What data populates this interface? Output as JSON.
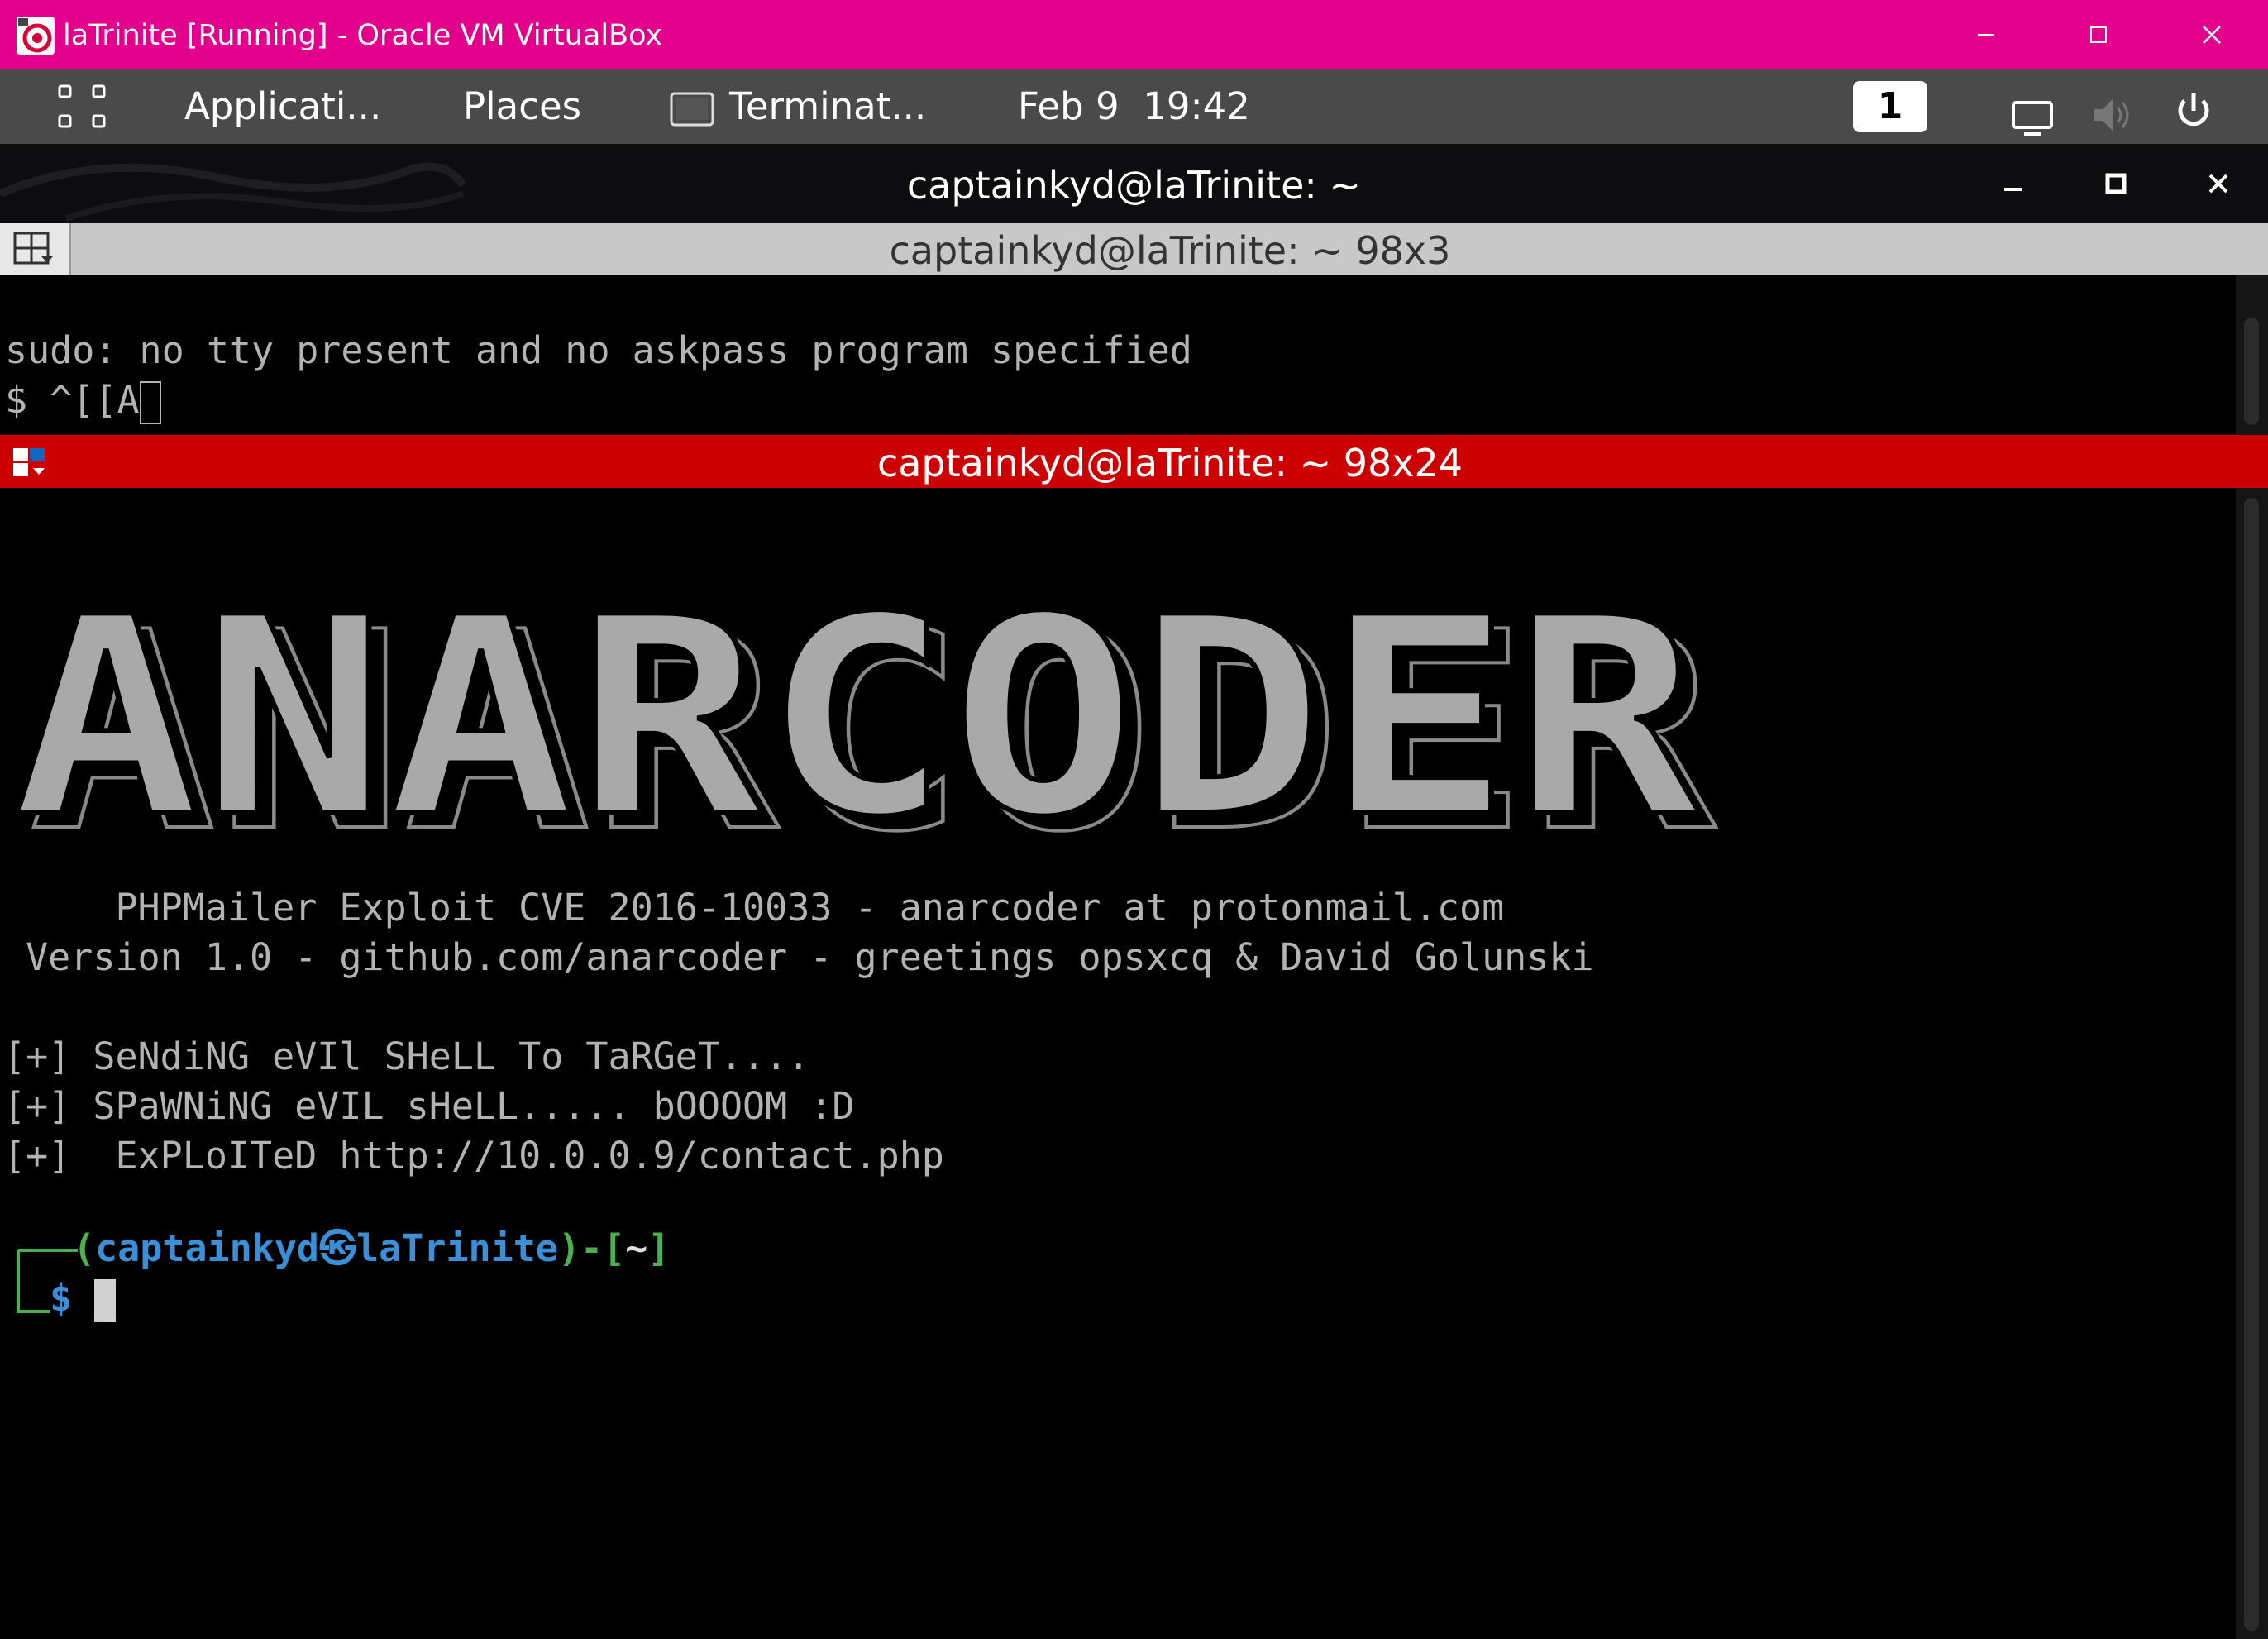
{
  "host_window": {
    "title": "laTrinite [Running] - Oracle VM VirtualBox",
    "accent_color": "#e3008c",
    "controls": [
      "minimize-icon",
      "maximize-icon",
      "close-icon"
    ]
  },
  "panel": {
    "apps_icon": "app-grid-icon",
    "applications_label": "Applicati...",
    "places_label": "Places",
    "task_label": "Terminat...",
    "date": "Feb 9",
    "time": "19:42",
    "workspace": "1",
    "tray_icons": [
      "display-icon",
      "volume-icon",
      "power-icon"
    ]
  },
  "terminal": {
    "window_title": "captainkyd@laTrinite: ~",
    "pane1": {
      "title": "captainkyd@laTrinite: ~ 98x3",
      "lines": [
        "sudo: no tty present and no askpass program specified",
        "$ ^[[A"
      ]
    },
    "pane2": {
      "title": "captainkyd@laTrinite: ~ 98x24",
      "header_color": "#cc0000",
      "banner_text": "ANARCODER",
      "info_line1": "     PHPMailer Exploit CVE 2016-10033 - anarcoder at protonmail.com",
      "info_line2": " Version 1.0 - github.com/anarcoder - greetings opsxcq & David Golunski",
      "status_lines": [
        "[+] SeNdiNG eVIl SHeLL To TaRGeT....",
        "[+] SPaWNiNG eVIL sHeLL..... bOOOOM :D",
        "[+]  ExPLoITeD http://10.0.0.9/contact.php"
      ],
      "prompt": {
        "user": "captainkyd",
        "separator_symbol": "㉿",
        "host": "laTrinite",
        "cwd": "~",
        "symbol": "$"
      }
    }
  }
}
